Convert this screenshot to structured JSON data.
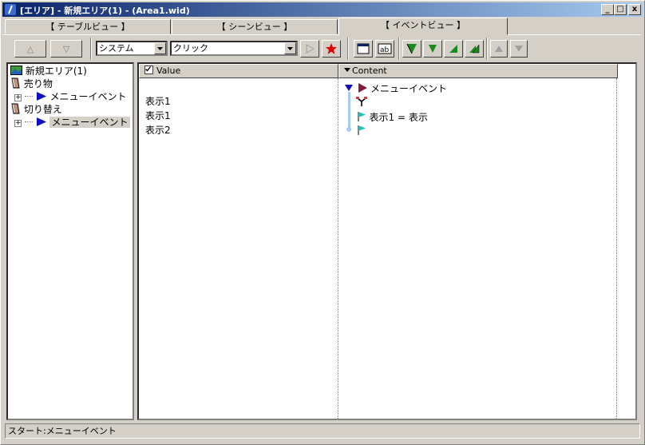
{
  "window": {
    "title": "[エリア] - 新規エリア(1) - (Area1.wid)",
    "minimize": "_",
    "maximize": "□",
    "close": "x"
  },
  "tabs": [
    {
      "label": "【 テーブルビュー 】"
    },
    {
      "label": "【 シーンビュー 】"
    },
    {
      "label": "【 イベントビュー 】",
      "active": true
    }
  ],
  "toolbar": {
    "up_label": "△",
    "down_label": "▽",
    "category_select": "システム",
    "event_select": "クリック"
  },
  "tree": {
    "root": "新規エリア(1)",
    "items": [
      {
        "label": "売り物",
        "child": "メニューイベント"
      },
      {
        "label": "切り替え",
        "child": "メニューイベント"
      }
    ]
  },
  "grid": {
    "columns": [
      "Value",
      "Content"
    ],
    "values": [
      "表示1",
      "表示1",
      "表示2"
    ],
    "content": {
      "event_title": "メニューイベント",
      "line": "表示1 = 表示"
    }
  },
  "status": "スタート:メニューイベント",
  "colors": {
    "title_start": "#0a246a",
    "title_end": "#a6caf0",
    "flag_green": "#1a8a1a",
    "flag_blue": "#1010c0"
  }
}
